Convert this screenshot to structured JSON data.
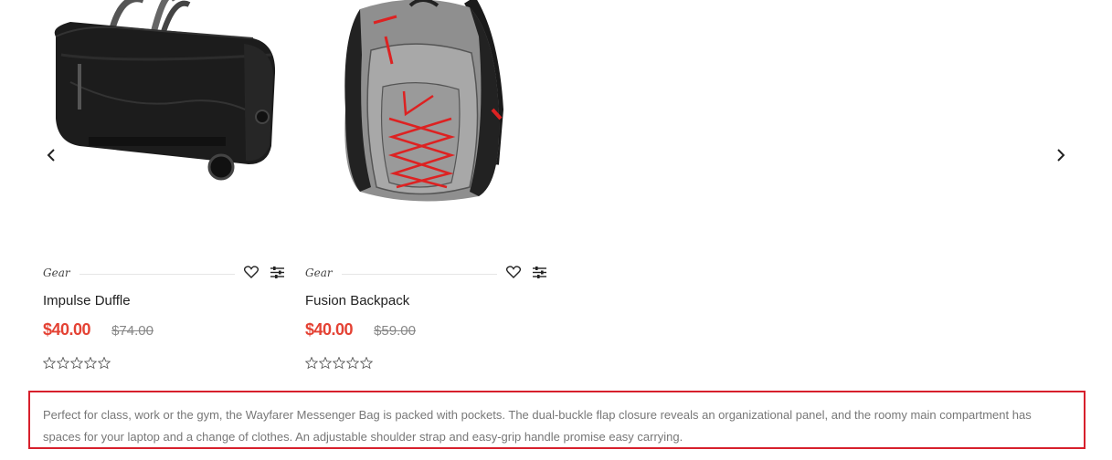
{
  "carousel": {
    "prev_icon": "chevron-left-icon",
    "next_icon": "chevron-right-icon",
    "products": [
      {
        "image": "duffle-bag-image",
        "category": "Gear",
        "name": "Impulse Duffle",
        "price": "$40.00",
        "old_price": "$74.00",
        "rating": 0,
        "wishlist_icon": "heart-icon",
        "compare_icon": "sliders-icon"
      },
      {
        "image": "backpack-image",
        "category": "Gear",
        "name": "Fusion Backpack",
        "price": "$40.00",
        "old_price": "$59.00",
        "rating": 0,
        "wishlist_icon": "heart-icon",
        "compare_icon": "sliders-icon"
      }
    ]
  },
  "description": {
    "text": "Perfect for class, work or the gym, the Wayfarer Messenger Bag is packed with pockets. The dual-buckle flap closure reveals an organizational panel, and the roomy main compartment has spaces for your laptop and a change of clothes. An adjustable shoulder strap and easy-grip handle promise easy carrying."
  },
  "colors": {
    "sale_price": "#e44234",
    "highlight_border": "#d7202c",
    "muted_text": "#777777"
  }
}
